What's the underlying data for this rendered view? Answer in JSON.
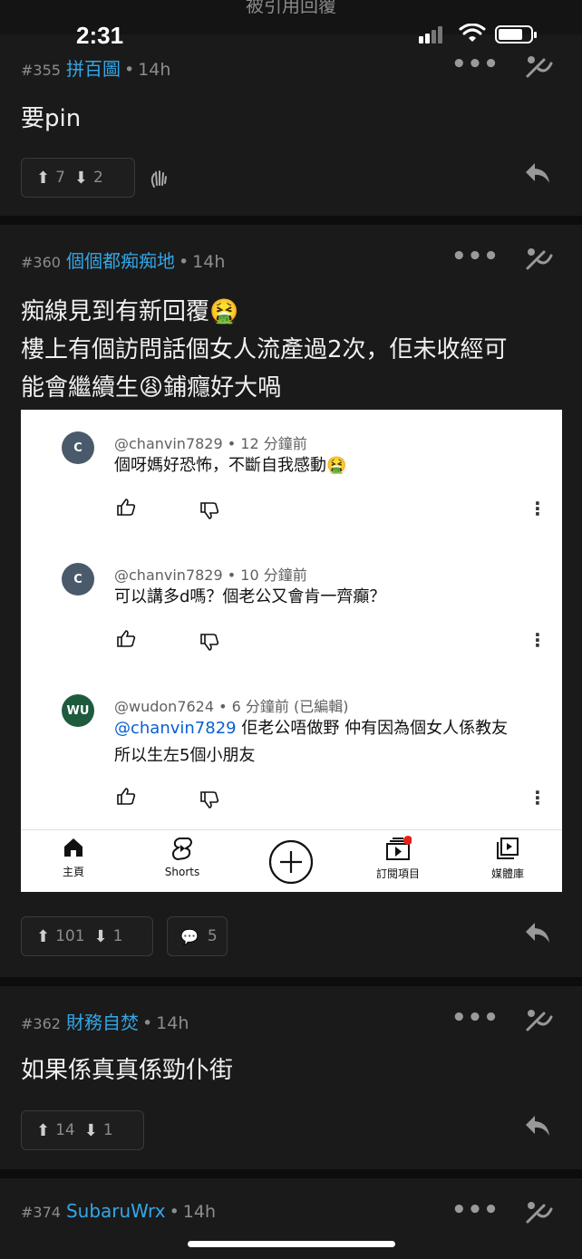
{
  "status_bar": {
    "title": "被引用回覆",
    "time": "2:31"
  },
  "posts": [
    {
      "number": "#355",
      "author": "拼百圖",
      "age": "14h",
      "body": [
        "要pin"
      ],
      "upvotes": "7",
      "downvotes": "2"
    },
    {
      "number": "#360",
      "author": "個個都痴痴地",
      "age": "14h",
      "body": [
        "痴線見到有新回覆🤮",
        "樓上有個訪問話個女人流產過2次，佢未收經可",
        "能會繼續生😩鋪癮好大喎"
      ],
      "upvotes": "101",
      "downvotes": "1",
      "comments": "5",
      "embedded_screenshot": {
        "comments": [
          {
            "avatar": "C",
            "avatar_color": "#4a5a6b",
            "user": "@chanvin7829 • 12 分鐘前",
            "text": [
              "個呀媽好恐怖，不斷自我感動🤮"
            ]
          },
          {
            "avatar": "C",
            "avatar_color": "#4a5a6b",
            "user": "@chanvin7829 • 10 分鐘前",
            "text": [
              "可以講多d嗎？個老公又會肯一齊癲？"
            ]
          },
          {
            "avatar": "WU",
            "avatar_color": "#1e5b3d",
            "user": "@wudon7624 • 6 分鐘前 (已編輯)",
            "mention": "@chanvin7829",
            "text": [
              " 佢老公唔做野  仲有因為個女人係教友",
              "所以生左5個小朋友"
            ]
          }
        ],
        "nav": {
          "home": "主頁",
          "shorts": "Shorts",
          "subscriptions": "訂閱項目",
          "library": "媒體庫"
        }
      }
    },
    {
      "number": "#362",
      "author": "財務自焚",
      "age": "14h",
      "body": [
        "如果係真真係勁仆街"
      ],
      "upvotes": "14",
      "downvotes": "1"
    },
    {
      "number": "#374",
      "author": "SubaruWrx",
      "age": "14h"
    }
  ],
  "colors": {
    "accent": "#33a7e8",
    "background": "#1a1a1a",
    "divider": "#0d0d0d"
  }
}
